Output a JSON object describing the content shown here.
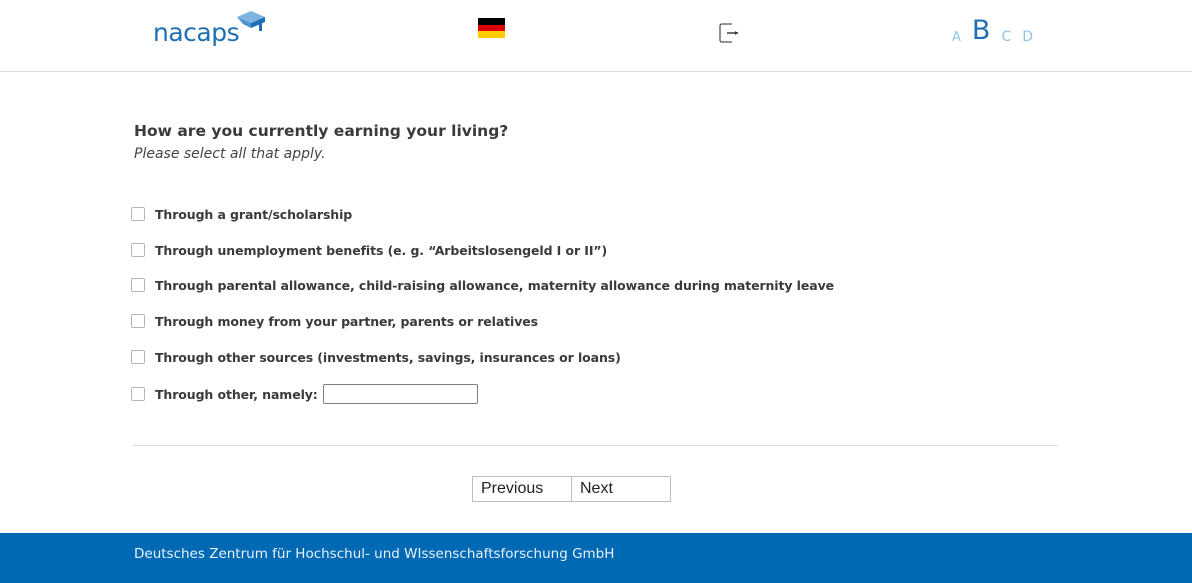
{
  "header": {
    "logo_text": "nacaps",
    "language_flag": "german-flag-icon",
    "logout_icon": "logout-icon",
    "font_sizes": [
      "A",
      "B",
      "C",
      "D"
    ],
    "active_font_size": "B"
  },
  "question": {
    "title": "How are you currently earning your living?",
    "hint": "Please select all that apply."
  },
  "options": [
    {
      "label": "Through a grant/scholarship",
      "checked": false
    },
    {
      "label": "Through unemployment benefits (e. g. “Arbeitslosengeld I or II”)",
      "checked": false
    },
    {
      "label": "Through parental allowance, child-raising allowance, maternity allowance during maternity leave",
      "checked": false
    },
    {
      "label": "Through money from your partner, parents or relatives",
      "checked": false
    },
    {
      "label": "Through other sources (investments, savings, insurances or loans)",
      "checked": false
    },
    {
      "label": "Through other, namely:",
      "checked": false,
      "input_value": ""
    }
  ],
  "navigation": {
    "previous_label": "Previous",
    "next_label": "Next"
  },
  "footer": {
    "text": "Deutsches Zentrum für Hochschul- und WIssenschaftsforschung GmbH"
  },
  "colors": {
    "brand_blue": "#0069b4",
    "logo_blue": "#1f6fb2",
    "light_blue": "#8fc3e8"
  }
}
